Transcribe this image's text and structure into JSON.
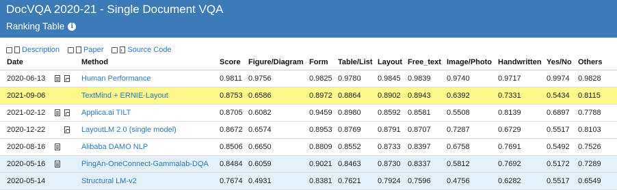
{
  "header": {
    "title": "DocVQA 2020-21 - Single Document VQA",
    "subtitle": "Ranking Table",
    "info_icon": "i"
  },
  "toggles": [
    {
      "label": "Description",
      "icon": "description-icon"
    },
    {
      "label": "Paper",
      "icon": "paper-pdf-icon"
    },
    {
      "label": "Source Code",
      "icon": "source-code-icon"
    }
  ],
  "table": {
    "columns": [
      "Date",
      "Method",
      "Score",
      "Figure/Diagram",
      "Form",
      "Table/List",
      "Layout",
      "Free_text",
      "Image/Photo",
      "Handwritten",
      "Yes/No",
      "Others"
    ],
    "rows": [
      {
        "style": "white",
        "date": "2020-06-13",
        "desc": true,
        "pdf": true,
        "method": "Human Performance",
        "values": [
          "0.9811",
          "0.9756",
          "0.9825",
          "0.9780",
          "0.9845",
          "0.9839",
          "0.9740",
          "0.9717",
          "0.9974",
          "0.9828"
        ]
      },
      {
        "style": "yellow",
        "date": "2021-09-06",
        "desc": false,
        "pdf": false,
        "method": "TextMind + ERNIE-Layout",
        "values": [
          "0.8753",
          "0.6586",
          "0.8972",
          "0.8864",
          "0.8902",
          "0.8943",
          "0.6392",
          "0.7331",
          "0.5434",
          "0.8115"
        ]
      },
      {
        "style": "white",
        "date": "2021-02-12",
        "desc": true,
        "pdf": true,
        "method": "Applica.ai TILT",
        "values": [
          "0.8705",
          "0.6082",
          "0.9459",
          "0.8980",
          "0.8592",
          "0.8581",
          "0.5508",
          "0.8139",
          "0.6897",
          "0.7788"
        ]
      },
      {
        "style": "white",
        "date": "2020-12-22",
        "desc": false,
        "pdf": true,
        "method": "LayoutLM 2.0 (single model)",
        "values": [
          "0.8672",
          "0.6574",
          "0.8953",
          "0.8769",
          "0.8791",
          "0.8707",
          "0.7287",
          "0.6729",
          "0.5517",
          "0.8103"
        ]
      },
      {
        "style": "white",
        "date": "2020-08-16",
        "desc": true,
        "pdf": false,
        "method": "Alibaba DAMO NLP",
        "values": [
          "0.8506",
          "0.6650",
          "0.8809",
          "0.8552",
          "0.8733",
          "0.8397",
          "0.6758",
          "0.7691",
          "0.5492",
          "0.7526"
        ]
      },
      {
        "style": "blue",
        "date": "2020-05-16",
        "desc": true,
        "pdf": false,
        "method": "PingAn-OneConnect-Gammalab-DQA",
        "values": [
          "0.8484",
          "0.6059",
          "0.9021",
          "0.8463",
          "0.8730",
          "0.8337",
          "0.5812",
          "0.7692",
          "0.5172",
          "0.7289"
        ]
      },
      {
        "style": "blue",
        "date": "2020-05-14",
        "desc": false,
        "pdf": false,
        "method": "Structural LM-v2",
        "values": [
          "0.7674",
          "0.4931",
          "0.8381",
          "0.7621",
          "0.7924",
          "0.7596",
          "0.4756",
          "0.6282",
          "0.5517",
          "0.6549"
        ]
      }
    ]
  }
}
